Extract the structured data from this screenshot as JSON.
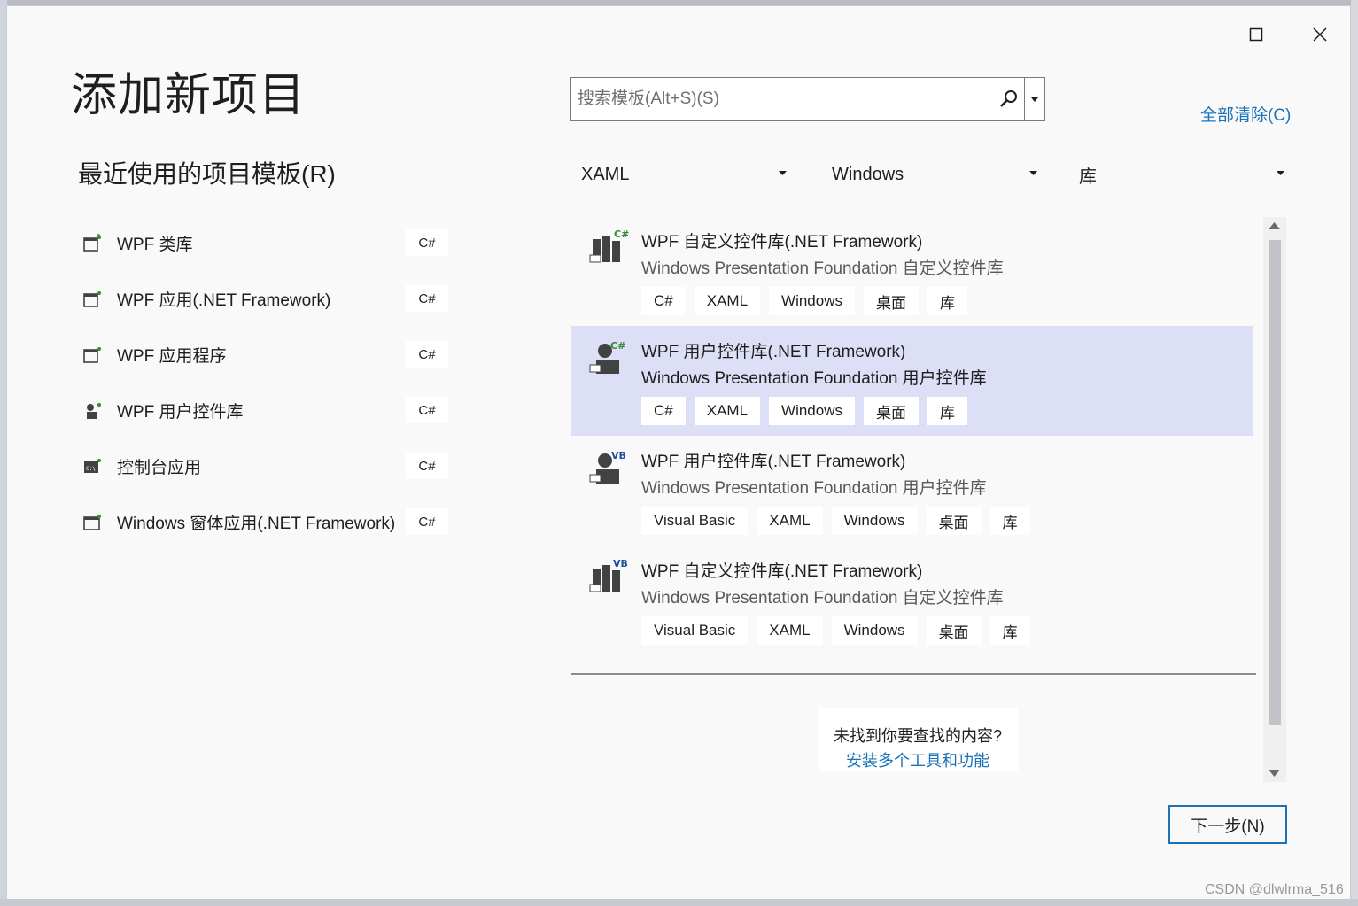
{
  "dialog": {
    "title": "添加新项目",
    "maximize_icon": "maximize-icon",
    "close_icon": "close-icon"
  },
  "recent": {
    "heading": "最近使用的项目模板(R)",
    "items": [
      {
        "label": "WPF 类库",
        "lang": "C#",
        "icon": "wpf-library-icon"
      },
      {
        "label": "WPF 应用(.NET Framework)",
        "lang": "C#",
        "icon": "wpf-app-icon"
      },
      {
        "label": "WPF 应用程序",
        "lang": "C#",
        "icon": "wpf-app-icon"
      },
      {
        "label": "WPF 用户控件库",
        "lang": "C#",
        "icon": "wpf-user-control-icon"
      },
      {
        "label": "控制台应用",
        "lang": "C#",
        "icon": "console-icon"
      },
      {
        "label": "Windows 窗体应用(.NET Framework)",
        "lang": "C#",
        "icon": "winforms-icon"
      }
    ]
  },
  "search": {
    "placeholder": "搜索模板(Alt+S)(S)",
    "clear_all": "全部清除(C)"
  },
  "filters": {
    "language": "XAML",
    "platform": "Windows",
    "project_type": "库"
  },
  "templates": [
    {
      "name": "WPF 自定义控件库(.NET Framework)",
      "desc": "Windows Presentation Foundation 自定义控件库",
      "tags": [
        "C#",
        "XAML",
        "Windows",
        "桌面",
        "库"
      ],
      "badge": "C#",
      "selected": false
    },
    {
      "name": "WPF 用户控件库(.NET Framework)",
      "desc": "Windows Presentation Foundation 用户控件库",
      "tags": [
        "C#",
        "XAML",
        "Windows",
        "桌面",
        "库"
      ],
      "badge": "C#",
      "selected": true
    },
    {
      "name": "WPF 用户控件库(.NET Framework)",
      "desc": "Windows Presentation Foundation 用户控件库",
      "tags": [
        "Visual Basic",
        "XAML",
        "Windows",
        "桌面",
        "库"
      ],
      "badge": "VB",
      "selected": false
    },
    {
      "name": "WPF 自定义控件库(.NET Framework)",
      "desc": "Windows Presentation Foundation 自定义控件库",
      "tags": [
        "Visual Basic",
        "XAML",
        "Windows",
        "桌面",
        "库"
      ],
      "badge": "VB",
      "selected": false
    }
  ],
  "not_found": {
    "question": "未找到你要查找的内容?",
    "link": "安装多个工具和功能"
  },
  "footer": {
    "next": "下一步(N)"
  },
  "watermark": "CSDN @dlwlrma_516",
  "colors": {
    "accent": "#1a73b8",
    "selection": "#dcdff5",
    "csharp_badge": "#388a34",
    "vb_badge": "#1f4e9c"
  }
}
